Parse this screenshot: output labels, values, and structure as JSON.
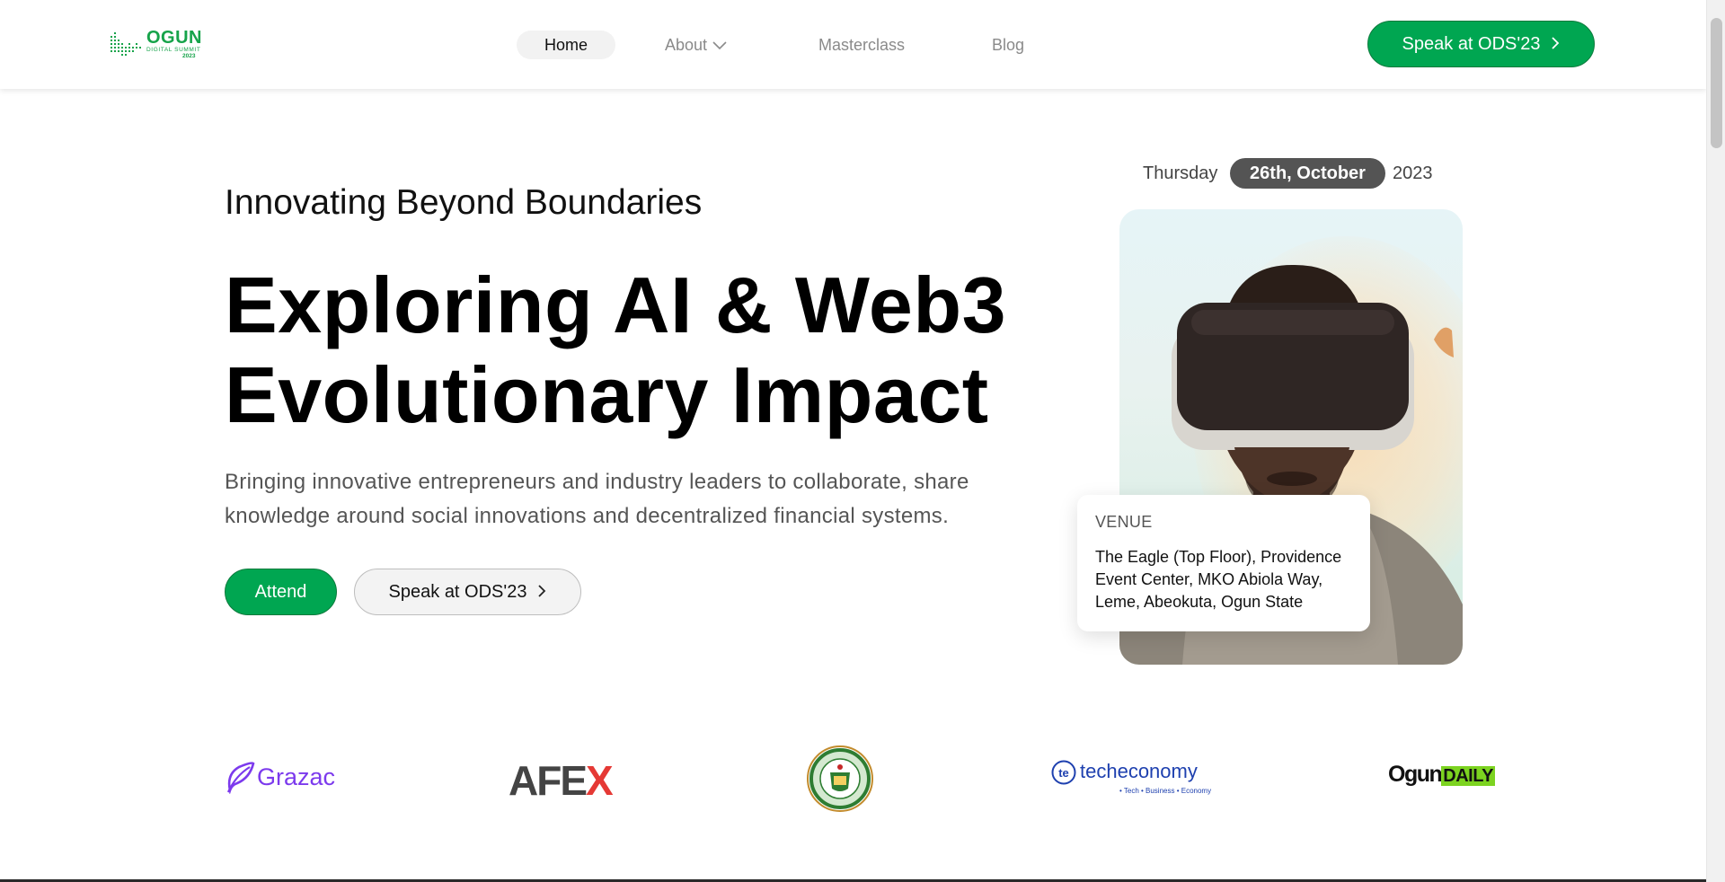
{
  "brand": {
    "title": "OGUN",
    "subtitle": "DIGITAL SUMMIT",
    "year": "2023",
    "accent_color": "#00a651"
  },
  "nav": {
    "home": "Home",
    "about": "About",
    "masterclass": "Masterclass",
    "blog": "Blog",
    "cta": "Speak at ODS'23"
  },
  "hero": {
    "tagline": "Innovating Beyond Boundaries",
    "headline_line1": "Exploring AI & Web3",
    "headline_line2": "Evolutionary Impact",
    "description": "Bringing innovative entrepreneurs and industry leaders to collaborate, share knowledge around social innovations and decentralized financial systems.",
    "attend_label": "Attend",
    "speak_label": "Speak at ODS'23"
  },
  "event": {
    "day": "Thursday",
    "date": "26th, October",
    "year": "2023",
    "venue_label": "VENUE",
    "venue_address": "The Eagle (Top Floor), Providence Event Center, MKO Abiola Way, Leme, Abeokuta, Ogun State"
  },
  "partners": {
    "grazac": "Grazac",
    "afex_prefix": "AFE",
    "afex_x": "X",
    "techeconomy": "techeconomy",
    "techeconomy_sub": "• Tech • Business • Economy",
    "ogun": "Ogun",
    "daily": "DAILY"
  }
}
